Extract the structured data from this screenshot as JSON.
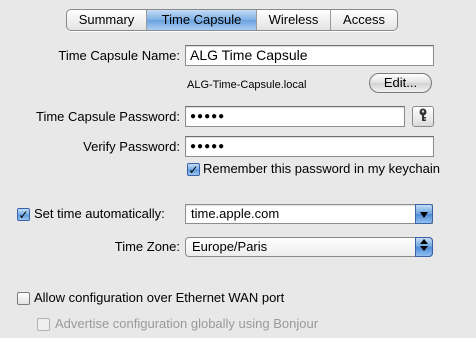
{
  "tabs": [
    {
      "label": "Summary",
      "selected": false
    },
    {
      "label": "Time Capsule",
      "selected": true
    },
    {
      "label": "Wireless",
      "selected": false
    },
    {
      "label": "Access",
      "selected": false
    }
  ],
  "name": {
    "label": "Time Capsule Name:",
    "value": "ALG Time Capsule",
    "hostname": "ALG-Time-Capsule.local",
    "edit_label": "Edit..."
  },
  "password": {
    "label": "Time Capsule Password:",
    "value": "●●●●●",
    "verify_label": "Verify Password:",
    "verify_value": "●●●●●",
    "keychain_icon": "key-icon",
    "remember_label": "Remember this password in my keychain",
    "remember_checked": true
  },
  "time": {
    "auto_label": "Set time automatically:",
    "auto_checked": true,
    "server_value": "time.apple.com",
    "zone_label": "Time Zone:",
    "zone_value": "Europe/Paris"
  },
  "wan": {
    "allow_label": "Allow configuration over Ethernet WAN port",
    "allow_checked": false,
    "advertise_label": "Advertise configuration globally using Bonjour",
    "advertise_checked": false,
    "advertise_enabled": false
  },
  "colors": {
    "window_bg": "#e8e8e8",
    "accent_blue": "#6aa2e0"
  }
}
